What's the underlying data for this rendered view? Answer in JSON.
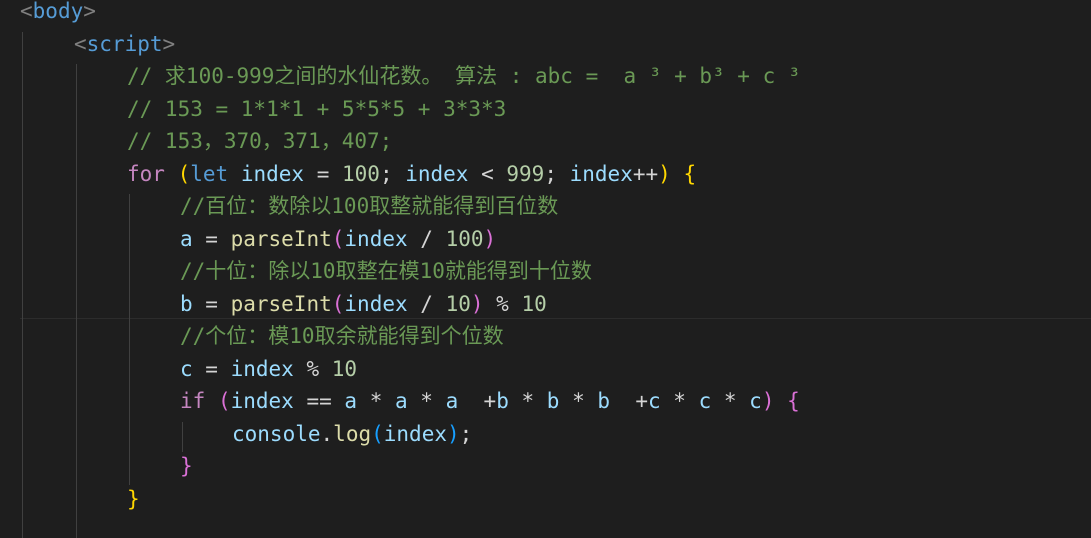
{
  "editor": {
    "lines": [
      {
        "indent": 0,
        "tokens": [
          {
            "t": "<",
            "c": "tag"
          },
          {
            "t": "body",
            "c": "tagname"
          },
          {
            "t": ">",
            "c": "tag"
          }
        ]
      },
      {
        "indent": 1,
        "tokens": [
          {
            "t": "<",
            "c": "tag"
          },
          {
            "t": "script",
            "c": "tagname"
          },
          {
            "t": ">",
            "c": "tag"
          }
        ]
      },
      {
        "indent": 2,
        "tokens": [
          {
            "t": "// 求100-999之间的水仙花数。 算法 : abc =  a ³ + b³ + c ³",
            "c": "cm"
          }
        ]
      },
      {
        "indent": 2,
        "tokens": [
          {
            "t": "// 153 = 1*1*1 + 5*5*5 + 3*3*3",
            "c": "cm"
          }
        ]
      },
      {
        "indent": 2,
        "tokens": [
          {
            "t": "// 153，370，371，407;",
            "c": "cm"
          }
        ]
      },
      {
        "indent": 2,
        "tokens": [
          {
            "t": "for",
            "c": "kw"
          },
          {
            "t": " ",
            "c": "op"
          },
          {
            "t": "(",
            "c": "br1"
          },
          {
            "t": "let",
            "c": "st"
          },
          {
            "t": " ",
            "c": "op"
          },
          {
            "t": "index",
            "c": "var"
          },
          {
            "t": " = ",
            "c": "op"
          },
          {
            "t": "100",
            "c": "num"
          },
          {
            "t": "; ",
            "c": "op"
          },
          {
            "t": "index",
            "c": "var"
          },
          {
            "t": " < ",
            "c": "op"
          },
          {
            "t": "999",
            "c": "num"
          },
          {
            "t": "; ",
            "c": "op"
          },
          {
            "t": "index",
            "c": "var"
          },
          {
            "t": "++",
            "c": "op"
          },
          {
            "t": ")",
            "c": "br1"
          },
          {
            "t": " ",
            "c": "op"
          },
          {
            "t": "{",
            "c": "br1"
          }
        ]
      },
      {
        "indent": 3,
        "tokens": [
          {
            "t": "//百位：数除以100取整就能得到百位数",
            "c": "cm"
          }
        ]
      },
      {
        "indent": 3,
        "tokens": [
          {
            "t": "a",
            "c": "var"
          },
          {
            "t": " = ",
            "c": "op"
          },
          {
            "t": "parseInt",
            "c": "fn"
          },
          {
            "t": "(",
            "c": "br2"
          },
          {
            "t": "index",
            "c": "var"
          },
          {
            "t": " / ",
            "c": "op"
          },
          {
            "t": "100",
            "c": "num"
          },
          {
            "t": ")",
            "c": "br2"
          }
        ]
      },
      {
        "indent": 3,
        "tokens": [
          {
            "t": "//十位：除以10取整在模10就能得到十位数",
            "c": "cm"
          }
        ]
      },
      {
        "indent": 3,
        "tokens": [
          {
            "t": "b",
            "c": "var"
          },
          {
            "t": " = ",
            "c": "op"
          },
          {
            "t": "parseInt",
            "c": "fn"
          },
          {
            "t": "(",
            "c": "br2"
          },
          {
            "t": "index",
            "c": "var"
          },
          {
            "t": " / ",
            "c": "op"
          },
          {
            "t": "10",
            "c": "num"
          },
          {
            "t": ")",
            "c": "br2"
          },
          {
            "t": " % ",
            "c": "op"
          },
          {
            "t": "10",
            "c": "num"
          }
        ]
      },
      {
        "indent": 3,
        "tokens": [
          {
            "t": "//个位：模10取余就能得到个位数",
            "c": "cm"
          }
        ]
      },
      {
        "indent": 3,
        "tokens": [
          {
            "t": "c",
            "c": "var"
          },
          {
            "t": " = ",
            "c": "op"
          },
          {
            "t": "index",
            "c": "var"
          },
          {
            "t": " % ",
            "c": "op"
          },
          {
            "t": "10",
            "c": "num"
          }
        ]
      },
      {
        "indent": 3,
        "tokens": [
          {
            "t": "if",
            "c": "kw"
          },
          {
            "t": " ",
            "c": "op"
          },
          {
            "t": "(",
            "c": "br2"
          },
          {
            "t": "index",
            "c": "var"
          },
          {
            "t": " == ",
            "c": "op"
          },
          {
            "t": "a",
            "c": "var"
          },
          {
            "t": " * ",
            "c": "op"
          },
          {
            "t": "a",
            "c": "var"
          },
          {
            "t": " * ",
            "c": "op"
          },
          {
            "t": "a",
            "c": "var"
          },
          {
            "t": "  +",
            "c": "op"
          },
          {
            "t": "b",
            "c": "var"
          },
          {
            "t": " * ",
            "c": "op"
          },
          {
            "t": "b",
            "c": "var"
          },
          {
            "t": " * ",
            "c": "op"
          },
          {
            "t": "b",
            "c": "var"
          },
          {
            "t": "  +",
            "c": "op"
          },
          {
            "t": "c",
            "c": "var"
          },
          {
            "t": " * ",
            "c": "op"
          },
          {
            "t": "c",
            "c": "var"
          },
          {
            "t": " * ",
            "c": "op"
          },
          {
            "t": "c",
            "c": "var"
          },
          {
            "t": ")",
            "c": "br2"
          },
          {
            "t": " ",
            "c": "op"
          },
          {
            "t": "{",
            "c": "br2"
          }
        ]
      },
      {
        "indent": 4,
        "tokens": [
          {
            "t": "console",
            "c": "var"
          },
          {
            "t": ".",
            "c": "op"
          },
          {
            "t": "log",
            "c": "fn"
          },
          {
            "t": "(",
            "c": "br3"
          },
          {
            "t": "index",
            "c": "var"
          },
          {
            "t": ")",
            "c": "br3"
          },
          {
            "t": ";",
            "c": "op"
          }
        ]
      },
      {
        "indent": 3,
        "tokens": [
          {
            "t": "}",
            "c": "br2"
          }
        ]
      },
      {
        "indent": 2,
        "tokens": [
          {
            "t": "}",
            "c": "br1"
          }
        ]
      }
    ]
  }
}
